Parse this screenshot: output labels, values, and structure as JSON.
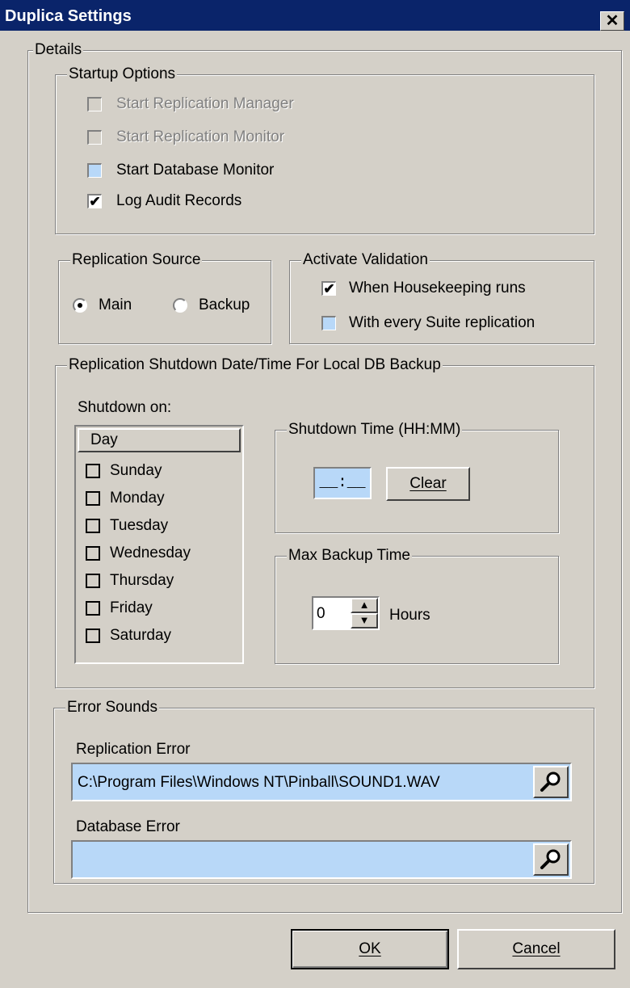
{
  "window": {
    "title": "Duplica Settings",
    "close_glyph": "✕"
  },
  "details": {
    "legend": "Details"
  },
  "startup": {
    "legend": "Startup Options",
    "items": [
      {
        "label": "Start Replication Manager",
        "checked": false,
        "enabled": false
      },
      {
        "label": "Start Replication Monitor",
        "checked": false,
        "enabled": false
      },
      {
        "label": "Start Database Monitor",
        "checked": false,
        "enabled": true
      },
      {
        "label": "Log Audit Records",
        "checked": true,
        "enabled": true
      }
    ]
  },
  "replication_source": {
    "legend": "Replication Source",
    "options": [
      "Main",
      "Backup"
    ],
    "selected": "Main"
  },
  "activate_validation": {
    "legend": "Activate Validation",
    "items": [
      {
        "label": "When Housekeeping runs",
        "checked": true
      },
      {
        "label": "With every Suite replication",
        "checked": false
      }
    ]
  },
  "shutdown": {
    "legend": "Replication Shutdown Date/Time For Local DB Backup",
    "shutdown_on_label": "Shutdown on:",
    "day_column_header": "Day",
    "days": [
      "Sunday",
      "Monday",
      "Tuesday",
      "Wednesday",
      "Thursday",
      "Friday",
      "Saturday"
    ],
    "time_group_legend": "Shutdown Time (HH:MM)",
    "time_value": "__:__",
    "clear_label": "Clear",
    "max_backup_legend": "Max Backup Time",
    "max_backup_value": "0",
    "hours_label": "Hours"
  },
  "error_sounds": {
    "legend": "Error Sounds",
    "replication_error_label": "Replication Error",
    "replication_error_value": "C:\\Program Files\\Windows NT\\Pinball\\SOUND1.WAV",
    "database_error_label": "Database Error",
    "database_error_value": "",
    "browse_icon": "magnifier-icon"
  },
  "footer": {
    "ok_label": "OK",
    "cancel_label": "Cancel"
  },
  "colors": {
    "titlebar": "#0a246a",
    "face": "#d4d0c8",
    "field_highlight": "#b8d8f8"
  }
}
